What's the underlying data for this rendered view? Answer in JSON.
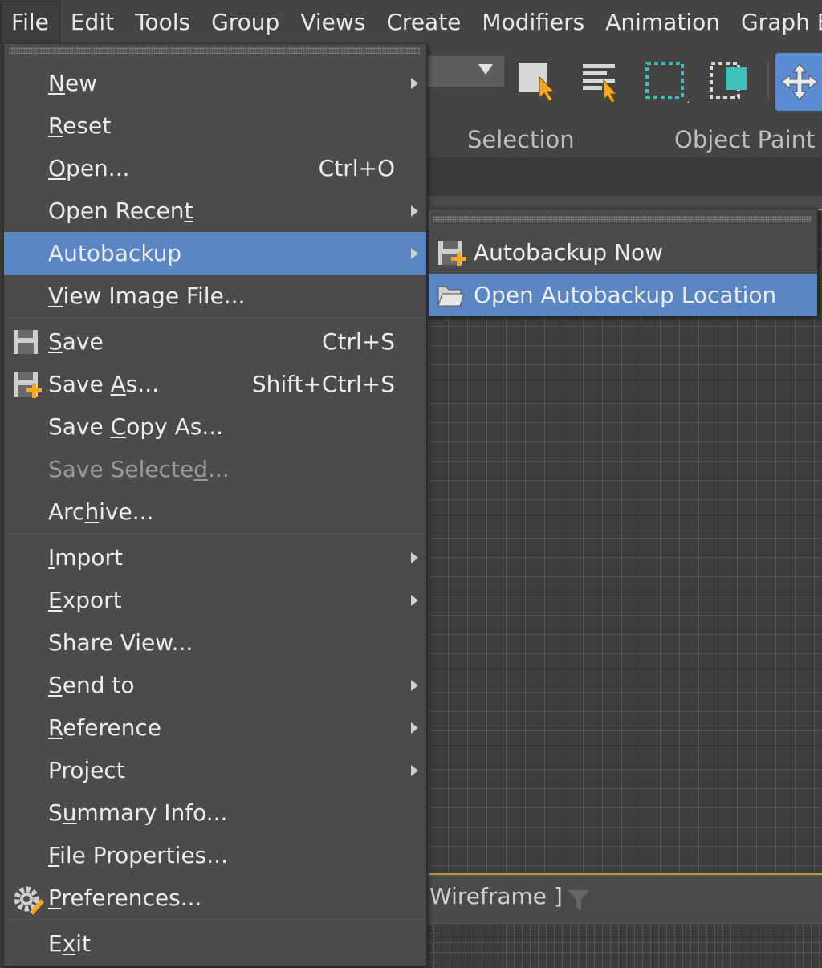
{
  "menubar": {
    "items": [
      "File",
      "Edit",
      "Tools",
      "Group",
      "Views",
      "Create",
      "Modifiers",
      "Animation",
      "Graph Edit"
    ]
  },
  "ribbon": {
    "selection_label": "Selection",
    "object_paint_label": "Object Paint"
  },
  "viewport": {
    "mode_label": "Wireframe ]"
  },
  "file_menu": {
    "items": [
      {
        "pre": "",
        "u": "N",
        "post": "ew",
        "shortcut": "",
        "submenu": true
      },
      {
        "pre": "",
        "u": "R",
        "post": "eset",
        "shortcut": "",
        "submenu": false
      },
      {
        "pre": "",
        "u": "O",
        "post": "pen...",
        "shortcut": "Ctrl+O",
        "submenu": false
      },
      {
        "pre": "Open Recen",
        "u": "t",
        "post": "",
        "shortcut": "",
        "submenu": true
      },
      {
        "pre": "Autobackup",
        "u": "",
        "post": "",
        "shortcut": "",
        "submenu": true,
        "highlighted": true
      },
      {
        "pre": "",
        "u": "V",
        "post": "iew Image File...",
        "shortcut": "",
        "submenu": false
      },
      {
        "pre": "",
        "u": "S",
        "post": "ave",
        "shortcut": "Ctrl+S",
        "submenu": false,
        "icon": "save-icon"
      },
      {
        "pre": "Save ",
        "u": "A",
        "post": "s...",
        "shortcut": "Shift+Ctrl+S",
        "submenu": false,
        "icon": "save-as-icon"
      },
      {
        "pre": "Save ",
        "u": "C",
        "post": "opy As...",
        "shortcut": "",
        "submenu": false
      },
      {
        "pre": "Save Selecte",
        "u": "d",
        "post": "...",
        "shortcut": "",
        "submenu": false,
        "disabled": true
      },
      {
        "pre": "Arc",
        "u": "h",
        "post": "ive...",
        "shortcut": "",
        "submenu": false
      },
      {
        "pre": "",
        "u": "I",
        "post": "mport",
        "shortcut": "",
        "submenu": true
      },
      {
        "pre": "",
        "u": "E",
        "post": "xport",
        "shortcut": "",
        "submenu": true
      },
      {
        "pre": "Share View...",
        "u": "",
        "post": "",
        "shortcut": "",
        "submenu": false
      },
      {
        "pre": "",
        "u": "S",
        "post": "end to",
        "shortcut": "",
        "submenu": true
      },
      {
        "pre": "",
        "u": "R",
        "post": "eference",
        "shortcut": "",
        "submenu": true
      },
      {
        "pre": "Project",
        "u": "",
        "post": "",
        "shortcut": "",
        "submenu": true
      },
      {
        "pre": "S",
        "u": "u",
        "post": "mmary Info...",
        "shortcut": "",
        "submenu": false
      },
      {
        "pre": "",
        "u": "F",
        "post": "ile Properties...",
        "shortcut": "",
        "submenu": false
      },
      {
        "pre": "",
        "u": "P",
        "post": "references...",
        "shortcut": "",
        "submenu": false,
        "icon": "preferences-gear-icon"
      },
      {
        "pre": "E",
        "u": "x",
        "post": "it",
        "shortcut": "",
        "submenu": false
      }
    ]
  },
  "autobackup_submenu": {
    "items": [
      {
        "label": "Autobackup Now",
        "icon": "autobackup-save-icon"
      },
      {
        "label": "Open Autobackup Location",
        "icon": "folder-icon",
        "highlighted": true
      }
    ]
  },
  "colors": {
    "highlight": "#5a87c4",
    "menu_bg": "#4b4b4b",
    "accent_yellow": "#f5a623",
    "teal": "#3cc0b8"
  }
}
